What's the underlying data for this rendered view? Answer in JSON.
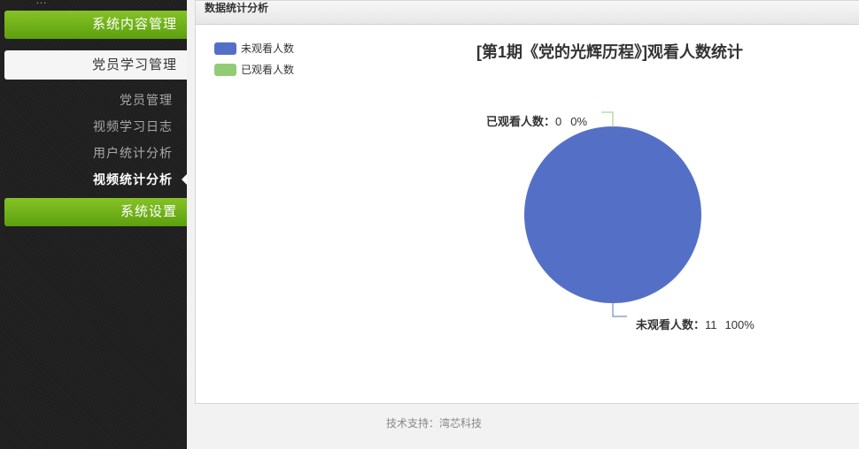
{
  "sidebar": {
    "top_stub": "…",
    "content_management": "系统内容管理",
    "member_study": "党员学习管理",
    "sub_items": [
      "党员管理",
      "视频学习日志",
      "用户统计分析",
      "视频统计分析"
    ],
    "system_settings": "系统设置"
  },
  "panel": {
    "title": "数据统计分析"
  },
  "footer": {
    "text": "技术支持：湾芯科技"
  },
  "colors": {
    "green_accent": "#6cb31a",
    "not_watched": "#5470c6",
    "watched": "#91cc75"
  },
  "chart_data": {
    "type": "pie",
    "title": "[第1期《党的光辉历程》]观看人数统计",
    "legend_placement": "top-left",
    "slices": [
      {
        "name": "未观看人数",
        "value": 11,
        "percent": "100%",
        "color": "#5470c6",
        "label_name": "未观看人数：",
        "label_value": "11",
        "label_percent": "100%"
      },
      {
        "name": "已观看人数",
        "value": 0,
        "percent": "0%",
        "color": "#91cc75",
        "label_name": "已观看人数：",
        "label_value": "0",
        "label_percent": "0%"
      }
    ]
  }
}
